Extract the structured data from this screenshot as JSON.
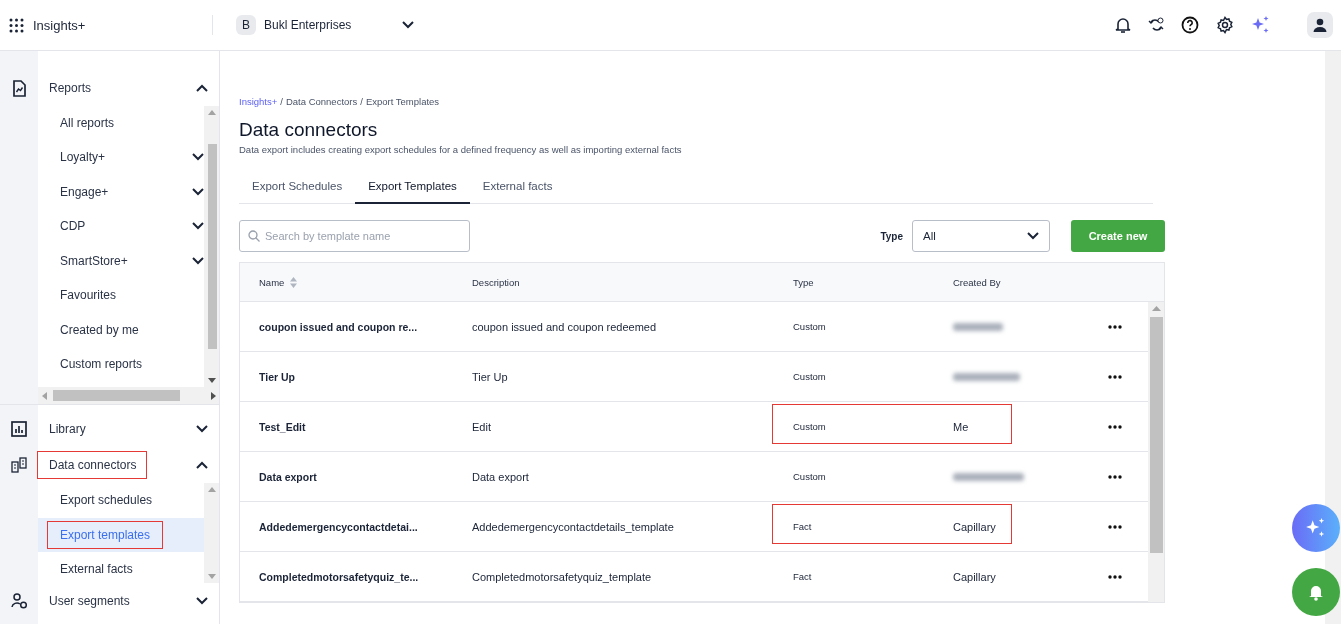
{
  "topbar": {
    "app_name": "Insights+",
    "org_initial": "B",
    "org_name": "Bukl Enterprises"
  },
  "sidebar": {
    "sections": [
      {
        "label": "Reports",
        "expanded": true,
        "highlighted": false,
        "items": [
          {
            "label": "All reports",
            "kind": "link",
            "selected": false,
            "highlighted": false
          },
          {
            "label": "Loyalty+",
            "kind": "group",
            "selected": false,
            "highlighted": false
          },
          {
            "label": "Engage+",
            "kind": "group",
            "selected": false,
            "highlighted": false
          },
          {
            "label": "CDP",
            "kind": "group",
            "selected": false,
            "highlighted": false
          },
          {
            "label": "SmartStore+",
            "kind": "group",
            "selected": false,
            "highlighted": false
          },
          {
            "label": "Favourites",
            "kind": "link",
            "selected": false,
            "highlighted": false
          },
          {
            "label": "Created by me",
            "kind": "link",
            "selected": false,
            "highlighted": false
          },
          {
            "label": "Custom reports",
            "kind": "link",
            "selected": false,
            "highlighted": false
          }
        ]
      },
      {
        "label": "Library",
        "expanded": false,
        "highlighted": false
      },
      {
        "label": "Data connectors",
        "expanded": true,
        "highlighted": true,
        "items": [
          {
            "label": "Export schedules",
            "kind": "link",
            "selected": false,
            "highlighted": false
          },
          {
            "label": "Export templates",
            "kind": "link",
            "selected": true,
            "highlighted": true
          },
          {
            "label": "External facts",
            "kind": "link",
            "selected": false,
            "highlighted": false
          }
        ]
      },
      {
        "label": "User segments",
        "expanded": false,
        "highlighted": false
      }
    ]
  },
  "breadcrumb": [
    {
      "label": "Insights+",
      "link": true
    },
    {
      "label": "Data Connectors",
      "link": false
    },
    {
      "label": "Export Templates",
      "link": false
    }
  ],
  "breadcrumb_separator": "/",
  "page_title": "Data connectors",
  "page_subtitle": "Data export includes creating export schedules for a defined frequency as well as importing external facts",
  "tabs": [
    {
      "label": "Export Schedules",
      "selected": false
    },
    {
      "label": "Export Templates",
      "selected": true
    },
    {
      "label": "External facts",
      "selected": false
    }
  ],
  "search": {
    "placeholder": "Search by template name"
  },
  "type_filter": {
    "label": "Type",
    "value": "All"
  },
  "create_button": "Create new",
  "table": {
    "columns": [
      "Name",
      "Description",
      "Type",
      "Created By"
    ],
    "rows": [
      {
        "name": "coupon issued and coupon re...",
        "description": "coupon issued and coupon redeemed",
        "type": "Custom",
        "created_by_blurred": true,
        "highlighted": false
      },
      {
        "name": "Tier Up",
        "description": "Tier Up",
        "type": "Custom",
        "created_by_blurred": true,
        "highlighted": false
      },
      {
        "name": "Test_Edit",
        "description": "Edit",
        "type": "Custom",
        "created_by": "Me",
        "created_by_blurred": false,
        "highlighted": true
      },
      {
        "name": "Data export",
        "description": "Data export",
        "type": "Custom",
        "created_by_blurred": true,
        "highlighted": false
      },
      {
        "name": "Addedemergencycontactdetai...",
        "description": "Addedemergencycontactdetails_template",
        "type": "Fact",
        "created_by": "Capillary",
        "created_by_blurred": false,
        "highlighted": true
      },
      {
        "name": "Completedmotorsafetyquiz_te...",
        "description": "Completedmotorsafetyquiz_template",
        "type": "Fact",
        "created_by": "Capillary",
        "created_by_blurred": false,
        "highlighted": false
      }
    ]
  }
}
